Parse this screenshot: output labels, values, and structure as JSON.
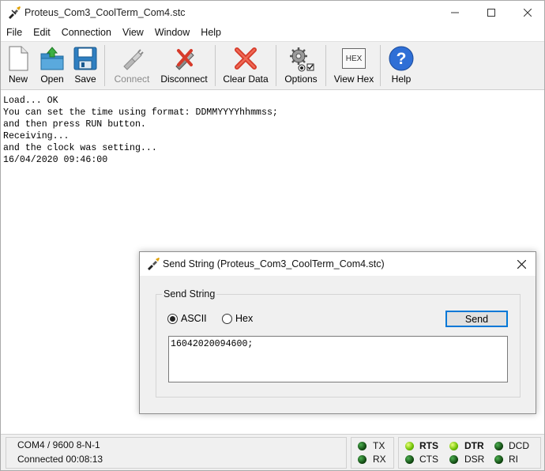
{
  "window": {
    "title": "Proteus_Com3_CoolTerm_Com4.stc"
  },
  "menu": [
    "File",
    "Edit",
    "Connection",
    "View",
    "Window",
    "Help"
  ],
  "toolbar": {
    "new_label": "New",
    "open_label": "Open",
    "save_label": "Save",
    "connect_label": "Connect",
    "disconnect_label": "Disconnect",
    "clear_label": "Clear Data",
    "options_label": "Options",
    "viewhex_label": "View Hex",
    "help_label": "Help",
    "hex_icon_text": "HEX"
  },
  "terminal": {
    "lines": [
      "Load... OK",
      "You can set the time using format: DDMMYYYYhhmmss;",
      "and then press RUN button.",
      "Receiving...",
      "and the clock was setting...",
      "16/04/2020 09:46:00"
    ]
  },
  "dialog": {
    "title": "Send String (Proteus_Com3_CoolTerm_Com4.stc)",
    "group_label": "Send String",
    "ascii_label": "ASCII",
    "hex_label": "Hex",
    "selected_mode": "ASCII",
    "send_label": "Send",
    "input_value": "16042020094600;"
  },
  "status": {
    "port": "COM4 / 9600 8-N-1",
    "connection": "Connected 00:08:13",
    "tx": "TX",
    "rx": "RX",
    "rts": "RTS",
    "cts": "CTS",
    "dtr": "DTR",
    "dsr": "DSR",
    "dcd": "DCD",
    "ri": "RI",
    "active_signals": [
      "RTS",
      "DTR"
    ]
  },
  "colors": {
    "accent": "#0078d7",
    "toolbar_bg": "#f0f0f0",
    "led_on": "#8fd400",
    "led_off": "#1f6b1f"
  }
}
